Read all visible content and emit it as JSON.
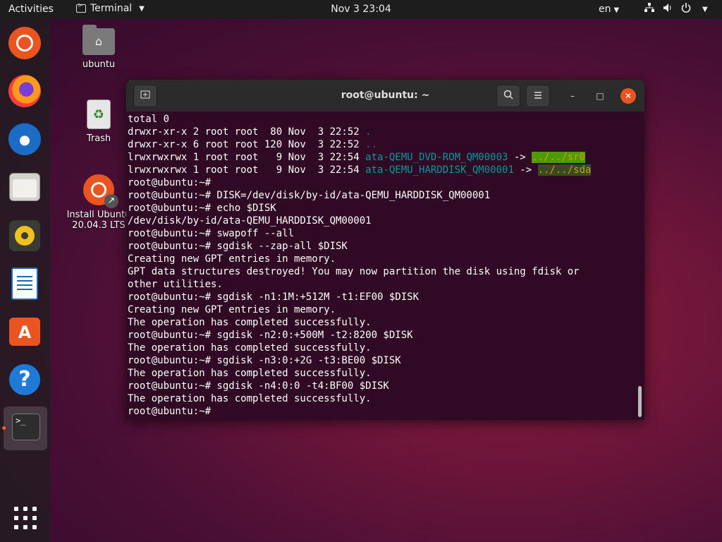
{
  "topbar": {
    "activities": "Activities",
    "app_name": "Terminal",
    "clock": "Nov 3  23:04",
    "language": "en",
    "network_icon": "network-icon",
    "volume_icon": "volume-icon",
    "power_icon": "power-icon"
  },
  "dock": {
    "items": [
      {
        "name": "ubuntu-logo-icon"
      },
      {
        "name": "firefox-icon"
      },
      {
        "name": "thunderbird-icon"
      },
      {
        "name": "files-icon"
      },
      {
        "name": "rhythmbox-icon"
      },
      {
        "name": "libreoffice-writer-icon"
      },
      {
        "name": "software-center-icon"
      },
      {
        "name": "help-icon"
      },
      {
        "name": "terminal-icon",
        "active": true
      }
    ],
    "show_apps": "show-applications-icon"
  },
  "desktop": {
    "home_label": "ubuntu",
    "trash_label": "Trash",
    "installer_label_line1": "Install Ubuntu",
    "installer_label_line2": "20.04.3 LTS"
  },
  "terminal": {
    "title": "root@ubuntu: ~",
    "lines": [
      {
        "segments": [
          {
            "t": "total 0"
          }
        ]
      },
      {
        "segments": [
          {
            "t": "drwxr-xr-x 2 root root  80 Nov  3 22:52 "
          },
          {
            "t": ".",
            "c": "dir"
          }
        ]
      },
      {
        "segments": [
          {
            "t": "drwxr-xr-x 6 root root 120 Nov  3 22:52 "
          },
          {
            "t": "..",
            "c": "dir"
          }
        ]
      },
      {
        "segments": [
          {
            "t": "lrwxrwxrwx 1 root root   9 Nov  3 22:54 "
          },
          {
            "t": "ata-QEMU_DVD-ROM_QM00003",
            "c": "link"
          },
          {
            "t": " -> "
          },
          {
            "t": "../../sr0",
            "c": "hl"
          }
        ]
      },
      {
        "segments": [
          {
            "t": "lrwxrwxrwx 1 root root   9 Nov  3 22:54 "
          },
          {
            "t": "ata-QEMU_HARDDISK_QM00001",
            "c": "link"
          },
          {
            "t": " -> "
          },
          {
            "t": "../../sda",
            "c": "hl2"
          }
        ]
      },
      {
        "segments": [
          {
            "t": "root@ubuntu:~#"
          }
        ]
      },
      {
        "segments": [
          {
            "t": "root@ubuntu:~# DISK=/dev/disk/by-id/ata-QEMU_HARDDISK_QM00001"
          }
        ]
      },
      {
        "segments": [
          {
            "t": "root@ubuntu:~# echo $DISK"
          }
        ]
      },
      {
        "segments": [
          {
            "t": "/dev/disk/by-id/ata-QEMU_HARDDISK_QM00001"
          }
        ]
      },
      {
        "segments": [
          {
            "t": "root@ubuntu:~# swapoff --all"
          }
        ]
      },
      {
        "segments": [
          {
            "t": "root@ubuntu:~# sgdisk --zap-all $DISK"
          }
        ]
      },
      {
        "segments": [
          {
            "t": "Creating new GPT entries in memory."
          }
        ]
      },
      {
        "segments": [
          {
            "t": "GPT data structures destroyed! You may now partition the disk using fdisk or"
          }
        ]
      },
      {
        "segments": [
          {
            "t": "other utilities."
          }
        ]
      },
      {
        "segments": [
          {
            "t": "root@ubuntu:~# sgdisk -n1:1M:+512M -t1:EF00 $DISK"
          }
        ]
      },
      {
        "segments": [
          {
            "t": "Creating new GPT entries in memory."
          }
        ]
      },
      {
        "segments": [
          {
            "t": "The operation has completed successfully."
          }
        ]
      },
      {
        "segments": [
          {
            "t": "root@ubuntu:~# sgdisk -n2:0:+500M -t2:8200 $DISK"
          }
        ]
      },
      {
        "segments": [
          {
            "t": "The operation has completed successfully."
          }
        ]
      },
      {
        "segments": [
          {
            "t": "root@ubuntu:~# sgdisk -n3:0:+2G -t3:BE00 $DISK"
          }
        ]
      },
      {
        "segments": [
          {
            "t": "The operation has completed successfully."
          }
        ]
      },
      {
        "segments": [
          {
            "t": "root@ubuntu:~# sgdisk -n4:0:0 -t4:BF00 $DISK"
          }
        ]
      },
      {
        "segments": [
          {
            "t": "The operation has completed successfully."
          }
        ]
      },
      {
        "segments": [
          {
            "t": "root@ubuntu:~#"
          }
        ]
      }
    ]
  },
  "colors": {
    "accent": "#e95420",
    "terminal_bg": "#300a24",
    "symlink": "#06989a",
    "directory": "#3465a4"
  }
}
